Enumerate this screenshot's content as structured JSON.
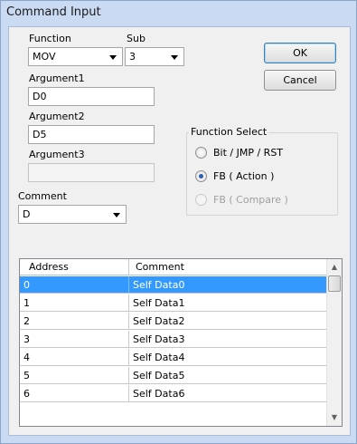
{
  "window": {
    "title": "Command Input"
  },
  "labels": {
    "function": "Function",
    "sub": "Sub",
    "argument1": "Argument1",
    "argument2": "Argument2",
    "argument3": "Argument3",
    "comment": "Comment"
  },
  "fields": {
    "function_value": "MOV",
    "sub_value": "3",
    "argument1_value": "D0",
    "argument2_value": "D5",
    "argument3_value": "",
    "comment_value": "D"
  },
  "buttons": {
    "ok": "OK",
    "cancel": "Cancel"
  },
  "function_select": {
    "title": "Function Select",
    "options": [
      {
        "label": "Bit / JMP / RST",
        "checked": false,
        "enabled": true
      },
      {
        "label": "FB ( Action )",
        "checked": true,
        "enabled": true
      },
      {
        "label": "FB ( Compare )",
        "checked": false,
        "enabled": false
      }
    ]
  },
  "table": {
    "columns": [
      "Address",
      "Comment"
    ],
    "rows": [
      {
        "address": "0",
        "comment": "Self Data0",
        "selected": true
      },
      {
        "address": "1",
        "comment": "Self Data1",
        "selected": false
      },
      {
        "address": "2",
        "comment": "Self Data2",
        "selected": false
      },
      {
        "address": "3",
        "comment": "Self Data3",
        "selected": false
      },
      {
        "address": "4",
        "comment": "Self Data4",
        "selected": false
      },
      {
        "address": "5",
        "comment": "Self Data5",
        "selected": false
      },
      {
        "address": "6",
        "comment": "Self Data6",
        "selected": false
      }
    ]
  },
  "icons": {
    "scroll_up": "scroll-up-arrow-icon",
    "scroll_down": "scroll-down-arrow-icon",
    "dropdown": "chevron-down-icon"
  },
  "colors": {
    "title_bar": "#c9daf2",
    "selection": "#3399ff",
    "radio_dot": "#2b5fb4"
  }
}
